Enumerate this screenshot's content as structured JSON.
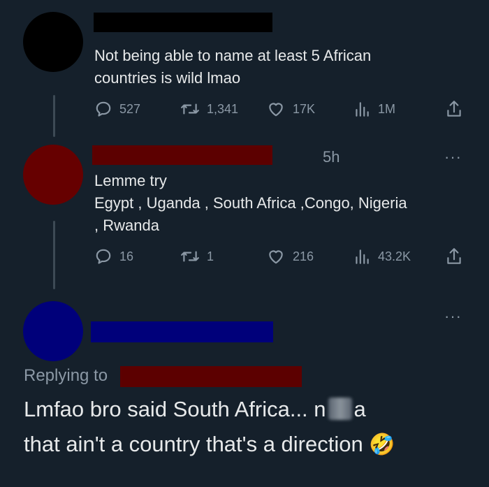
{
  "tweet1": {
    "text_line1": "Not being able to name at least 5 African",
    "text_line2": "countries is wild lmao",
    "replies": "527",
    "retweets": "1,341",
    "likes": "17K",
    "views": "1M",
    "icons": [
      "reply-icon",
      "retweet-icon",
      "like-icon",
      "views-icon",
      "share-icon"
    ]
  },
  "tweet2": {
    "time": "5h",
    "text_line1": "Lemme try",
    "text_line2": "Egypt , Uganda , South Africa ,Congo, Nigeria",
    "text_line3": ", Rwanda",
    "replies": "16",
    "retweets": "1",
    "likes": "216",
    "views": "43.2K",
    "more": "···"
  },
  "tweet3": {
    "replying_to": "Replying to",
    "text_line1_a": "Lmfao bro said South Africa... n",
    "text_line1_b": "a",
    "text_line2": "that ain't a country that's a direction",
    "emoji": "🤣",
    "more": "···"
  },
  "colors": {
    "background": "#15202b",
    "text": "#e7e9ea",
    "muted": "#8b98a5",
    "redact_black": "#000000",
    "redact_red": "#5c0000",
    "redact_blue": "#00007a"
  }
}
